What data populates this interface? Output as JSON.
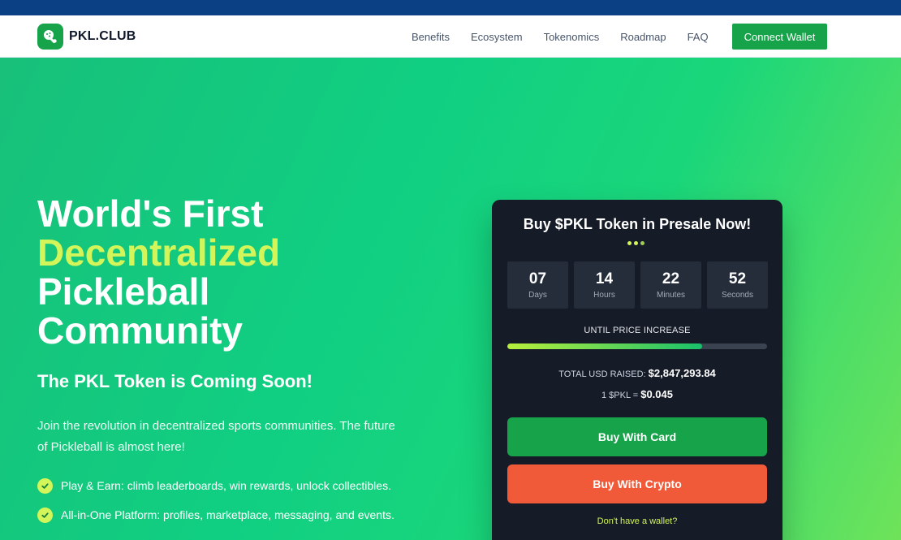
{
  "brand": {
    "name": "PKL.CLUB",
    "logo_icon": "pickleball-paddle-icon",
    "color": "#16a34a"
  },
  "nav": {
    "links": [
      "Benefits",
      "Ecosystem",
      "Tokenomics",
      "Roadmap",
      "FAQ"
    ],
    "cta": "Connect Wallet"
  },
  "hero": {
    "headline_line1": "World's First",
    "headline_accent": "Decentralized",
    "headline_line3": "Pickleball",
    "headline_line4": "Community",
    "subtitle": "The PKL Token is Coming Soon!",
    "intro": "Join the revolution in decentralized sports communities. The future of Pickleball is almost here!",
    "features": [
      "Play & Earn: climb leaderboards, win rewards, unlock collectibles.",
      "All-in-One Platform: profiles, marketplace, messaging, and events."
    ]
  },
  "presale": {
    "title": "Buy $PKL Token in Presale Now!",
    "countdown": [
      {
        "value": "07",
        "label": "Days"
      },
      {
        "value": "14",
        "label": "Hours"
      },
      {
        "value": "22",
        "label": "Minutes"
      },
      {
        "value": "52",
        "label": "Seconds"
      }
    ],
    "until_label": "UNTIL PRICE INCREASE",
    "progress_fraction": 0.75,
    "raised_label": "TOTAL USD RAISED:",
    "raised_value": "$2,847,293.84",
    "rate_label": "1 $PKL =",
    "rate_value": "$0.045",
    "buy_card": "Buy With Card",
    "buy_crypto": "Buy With Crypto",
    "no_wallet": "Don't have a wallet?"
  },
  "colors": {
    "accent_lime": "#d4f55a",
    "card_bg": "#151b27",
    "crypto_button": "#f05a38",
    "topbar": "#0b4184"
  }
}
